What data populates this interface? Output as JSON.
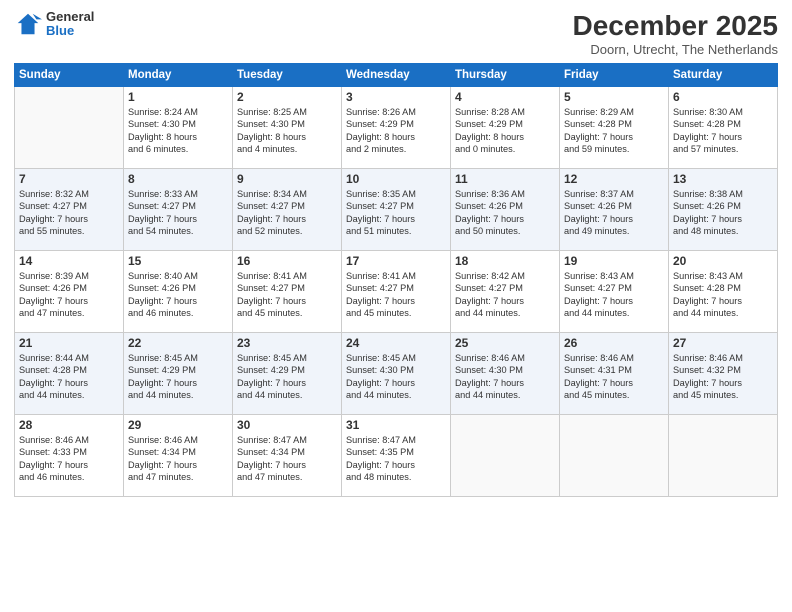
{
  "logo": {
    "general": "General",
    "blue": "Blue"
  },
  "title": "December 2025",
  "location": "Doorn, Utrecht, The Netherlands",
  "days_of_week": [
    "Sunday",
    "Monday",
    "Tuesday",
    "Wednesday",
    "Thursday",
    "Friday",
    "Saturday"
  ],
  "weeks": [
    [
      {
        "day": "",
        "info": ""
      },
      {
        "day": "1",
        "info": "Sunrise: 8:24 AM\nSunset: 4:30 PM\nDaylight: 8 hours\nand 6 minutes."
      },
      {
        "day": "2",
        "info": "Sunrise: 8:25 AM\nSunset: 4:30 PM\nDaylight: 8 hours\nand 4 minutes."
      },
      {
        "day": "3",
        "info": "Sunrise: 8:26 AM\nSunset: 4:29 PM\nDaylight: 8 hours\nand 2 minutes."
      },
      {
        "day": "4",
        "info": "Sunrise: 8:28 AM\nSunset: 4:29 PM\nDaylight: 8 hours\nand 0 minutes."
      },
      {
        "day": "5",
        "info": "Sunrise: 8:29 AM\nSunset: 4:28 PM\nDaylight: 7 hours\nand 59 minutes."
      },
      {
        "day": "6",
        "info": "Sunrise: 8:30 AM\nSunset: 4:28 PM\nDaylight: 7 hours\nand 57 minutes."
      }
    ],
    [
      {
        "day": "7",
        "info": "Sunrise: 8:32 AM\nSunset: 4:27 PM\nDaylight: 7 hours\nand 55 minutes."
      },
      {
        "day": "8",
        "info": "Sunrise: 8:33 AM\nSunset: 4:27 PM\nDaylight: 7 hours\nand 54 minutes."
      },
      {
        "day": "9",
        "info": "Sunrise: 8:34 AM\nSunset: 4:27 PM\nDaylight: 7 hours\nand 52 minutes."
      },
      {
        "day": "10",
        "info": "Sunrise: 8:35 AM\nSunset: 4:27 PM\nDaylight: 7 hours\nand 51 minutes."
      },
      {
        "day": "11",
        "info": "Sunrise: 8:36 AM\nSunset: 4:26 PM\nDaylight: 7 hours\nand 50 minutes."
      },
      {
        "day": "12",
        "info": "Sunrise: 8:37 AM\nSunset: 4:26 PM\nDaylight: 7 hours\nand 49 minutes."
      },
      {
        "day": "13",
        "info": "Sunrise: 8:38 AM\nSunset: 4:26 PM\nDaylight: 7 hours\nand 48 minutes."
      }
    ],
    [
      {
        "day": "14",
        "info": "Sunrise: 8:39 AM\nSunset: 4:26 PM\nDaylight: 7 hours\nand 47 minutes."
      },
      {
        "day": "15",
        "info": "Sunrise: 8:40 AM\nSunset: 4:26 PM\nDaylight: 7 hours\nand 46 minutes."
      },
      {
        "day": "16",
        "info": "Sunrise: 8:41 AM\nSunset: 4:27 PM\nDaylight: 7 hours\nand 45 minutes."
      },
      {
        "day": "17",
        "info": "Sunrise: 8:41 AM\nSunset: 4:27 PM\nDaylight: 7 hours\nand 45 minutes."
      },
      {
        "day": "18",
        "info": "Sunrise: 8:42 AM\nSunset: 4:27 PM\nDaylight: 7 hours\nand 44 minutes."
      },
      {
        "day": "19",
        "info": "Sunrise: 8:43 AM\nSunset: 4:27 PM\nDaylight: 7 hours\nand 44 minutes."
      },
      {
        "day": "20",
        "info": "Sunrise: 8:43 AM\nSunset: 4:28 PM\nDaylight: 7 hours\nand 44 minutes."
      }
    ],
    [
      {
        "day": "21",
        "info": "Sunrise: 8:44 AM\nSunset: 4:28 PM\nDaylight: 7 hours\nand 44 minutes."
      },
      {
        "day": "22",
        "info": "Sunrise: 8:45 AM\nSunset: 4:29 PM\nDaylight: 7 hours\nand 44 minutes."
      },
      {
        "day": "23",
        "info": "Sunrise: 8:45 AM\nSunset: 4:29 PM\nDaylight: 7 hours\nand 44 minutes."
      },
      {
        "day": "24",
        "info": "Sunrise: 8:45 AM\nSunset: 4:30 PM\nDaylight: 7 hours\nand 44 minutes."
      },
      {
        "day": "25",
        "info": "Sunrise: 8:46 AM\nSunset: 4:30 PM\nDaylight: 7 hours\nand 44 minutes."
      },
      {
        "day": "26",
        "info": "Sunrise: 8:46 AM\nSunset: 4:31 PM\nDaylight: 7 hours\nand 45 minutes."
      },
      {
        "day": "27",
        "info": "Sunrise: 8:46 AM\nSunset: 4:32 PM\nDaylight: 7 hours\nand 45 minutes."
      }
    ],
    [
      {
        "day": "28",
        "info": "Sunrise: 8:46 AM\nSunset: 4:33 PM\nDaylight: 7 hours\nand 46 minutes."
      },
      {
        "day": "29",
        "info": "Sunrise: 8:46 AM\nSunset: 4:34 PM\nDaylight: 7 hours\nand 47 minutes."
      },
      {
        "day": "30",
        "info": "Sunrise: 8:47 AM\nSunset: 4:34 PM\nDaylight: 7 hours\nand 47 minutes."
      },
      {
        "day": "31",
        "info": "Sunrise: 8:47 AM\nSunset: 4:35 PM\nDaylight: 7 hours\nand 48 minutes."
      },
      {
        "day": "",
        "info": ""
      },
      {
        "day": "",
        "info": ""
      },
      {
        "day": "",
        "info": ""
      }
    ]
  ]
}
